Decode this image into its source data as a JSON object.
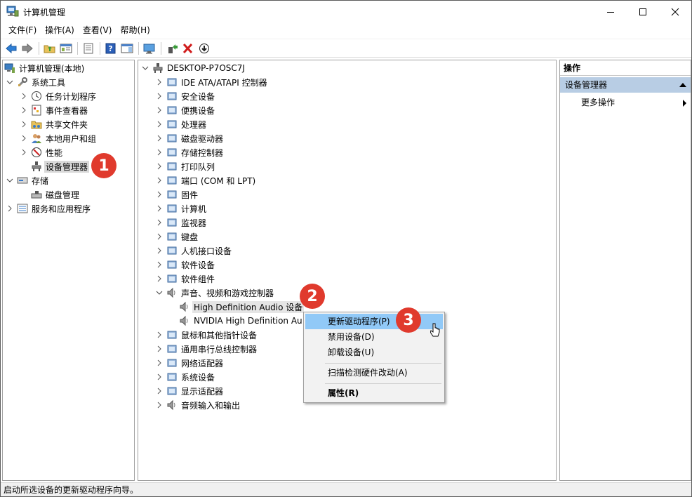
{
  "window": {
    "title": "计算机管理"
  },
  "menu": [
    "文件(F)",
    "操作(A)",
    "查看(V)",
    "帮助(H)"
  ],
  "left_tree": [
    {
      "label": "计算机管理(本地)",
      "icon": "computer-management-icon",
      "level": 0,
      "expanded": null
    },
    {
      "label": "系统工具",
      "icon": "tools-icon",
      "level": 1,
      "expanded": true
    },
    {
      "label": "任务计划程序",
      "icon": "clock-icon",
      "level": 2,
      "expanded": false
    },
    {
      "label": "事件查看器",
      "icon": "event-viewer-icon",
      "level": 2,
      "expanded": false
    },
    {
      "label": "共享文件夹",
      "icon": "shared-folder-icon",
      "level": 2,
      "expanded": false
    },
    {
      "label": "本地用户和组",
      "icon": "users-icon",
      "level": 2,
      "expanded": false
    },
    {
      "label": "性能",
      "icon": "performance-icon",
      "level": 2,
      "expanded": false
    },
    {
      "label": "设备管理器",
      "icon": "device-manager-icon",
      "level": 2,
      "expanded": null,
      "selected": true
    },
    {
      "label": "存储",
      "icon": "storage-icon",
      "level": 1,
      "expanded": true
    },
    {
      "label": "磁盘管理",
      "icon": "disk-management-icon",
      "level": 2,
      "expanded": null
    },
    {
      "label": "服务和应用程序",
      "icon": "services-icon",
      "level": 1,
      "expanded": false
    }
  ],
  "device_tree": {
    "root": "DESKTOP-P7OSC7J",
    "items": [
      {
        "label": "IDE ATA/ATAPI 控制器",
        "icon": "ide-controller-icon"
      },
      {
        "label": "安全设备",
        "icon": "security-device-icon"
      },
      {
        "label": "便携设备",
        "icon": "portable-device-icon"
      },
      {
        "label": "处理器",
        "icon": "processor-icon"
      },
      {
        "label": "磁盘驱动器",
        "icon": "disk-drive-icon"
      },
      {
        "label": "存储控制器",
        "icon": "storage-controller-icon"
      },
      {
        "label": "打印队列",
        "icon": "printer-icon"
      },
      {
        "label": "端口 (COM 和 LPT)",
        "icon": "port-icon"
      },
      {
        "label": "固件",
        "icon": "firmware-icon"
      },
      {
        "label": "计算机",
        "icon": "computer-icon"
      },
      {
        "label": "监视器",
        "icon": "monitor-icon"
      },
      {
        "label": "键盘",
        "icon": "keyboard-icon"
      },
      {
        "label": "人机接口设备",
        "icon": "hid-icon"
      },
      {
        "label": "软件设备",
        "icon": "software-device-icon"
      },
      {
        "label": "软件组件",
        "icon": "software-component-icon"
      },
      {
        "label": "声音、视频和游戏控制器",
        "icon": "speaker-icon",
        "expanded": true,
        "children": [
          "High Definition Audio 设备",
          "NVIDIA High Definition Au"
        ]
      },
      {
        "label": "鼠标和其他指针设备",
        "icon": "mouse-icon"
      },
      {
        "label": "通用串行总线控制器",
        "icon": "usb-icon"
      },
      {
        "label": "网络适配器",
        "icon": "network-adapter-icon"
      },
      {
        "label": "系统设备",
        "icon": "system-device-icon"
      },
      {
        "label": "显示适配器",
        "icon": "display-adapter-icon"
      },
      {
        "label": "音频输入和输出",
        "icon": "audio-io-icon"
      }
    ]
  },
  "actions": {
    "header": "操作",
    "section": "设备管理器",
    "more": "更多操作"
  },
  "context_menu": {
    "items": [
      "更新驱动程序(P)",
      "禁用设备(D)",
      "卸载设备(U)",
      "扫描检测硬件改动(A)",
      "属性(R)"
    ]
  },
  "badges": [
    "1",
    "2",
    "3"
  ],
  "status": "启动所选设备的更新驱动程序向导。",
  "colors": {
    "selection": "#91c9f7",
    "section_bg": "#b8cde4",
    "badge": "#e03a2d",
    "tree_selected": "#d9d9d9"
  }
}
